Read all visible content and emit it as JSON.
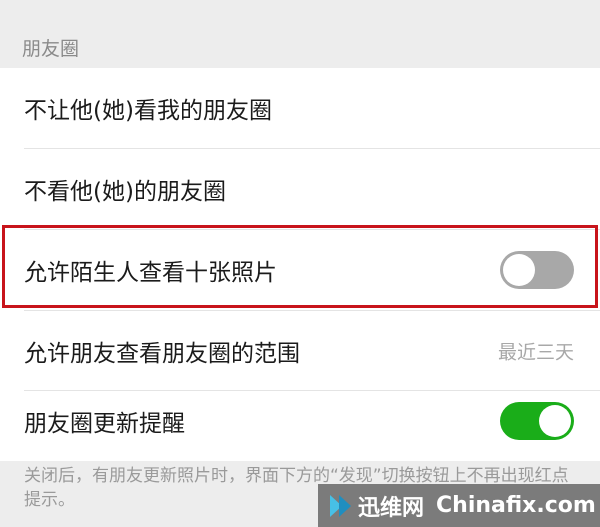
{
  "section": {
    "title": "朋友圈"
  },
  "items": [
    {
      "label": "不让他(她)看我的朋友圈"
    },
    {
      "label": "不看他(她)的朋友圈"
    },
    {
      "label": "允许陌生人查看十张照片",
      "toggle": "off"
    },
    {
      "label": "允许朋友查看朋友圈的范围",
      "value": "最近三天"
    },
    {
      "label": "朋友圈更新提醒",
      "toggle": "on"
    }
  ],
  "footer_note": "关闭后，有朋友更新照片时，界面下方的“发现”切换按钮上不再出现红点提示。",
  "watermark": {
    "brand": "迅维网",
    "site": "Chinafix.com"
  },
  "colors": {
    "toggle_on": "#1aad19",
    "toggle_off": "#a8a8a8",
    "highlight": "#c8141b"
  }
}
